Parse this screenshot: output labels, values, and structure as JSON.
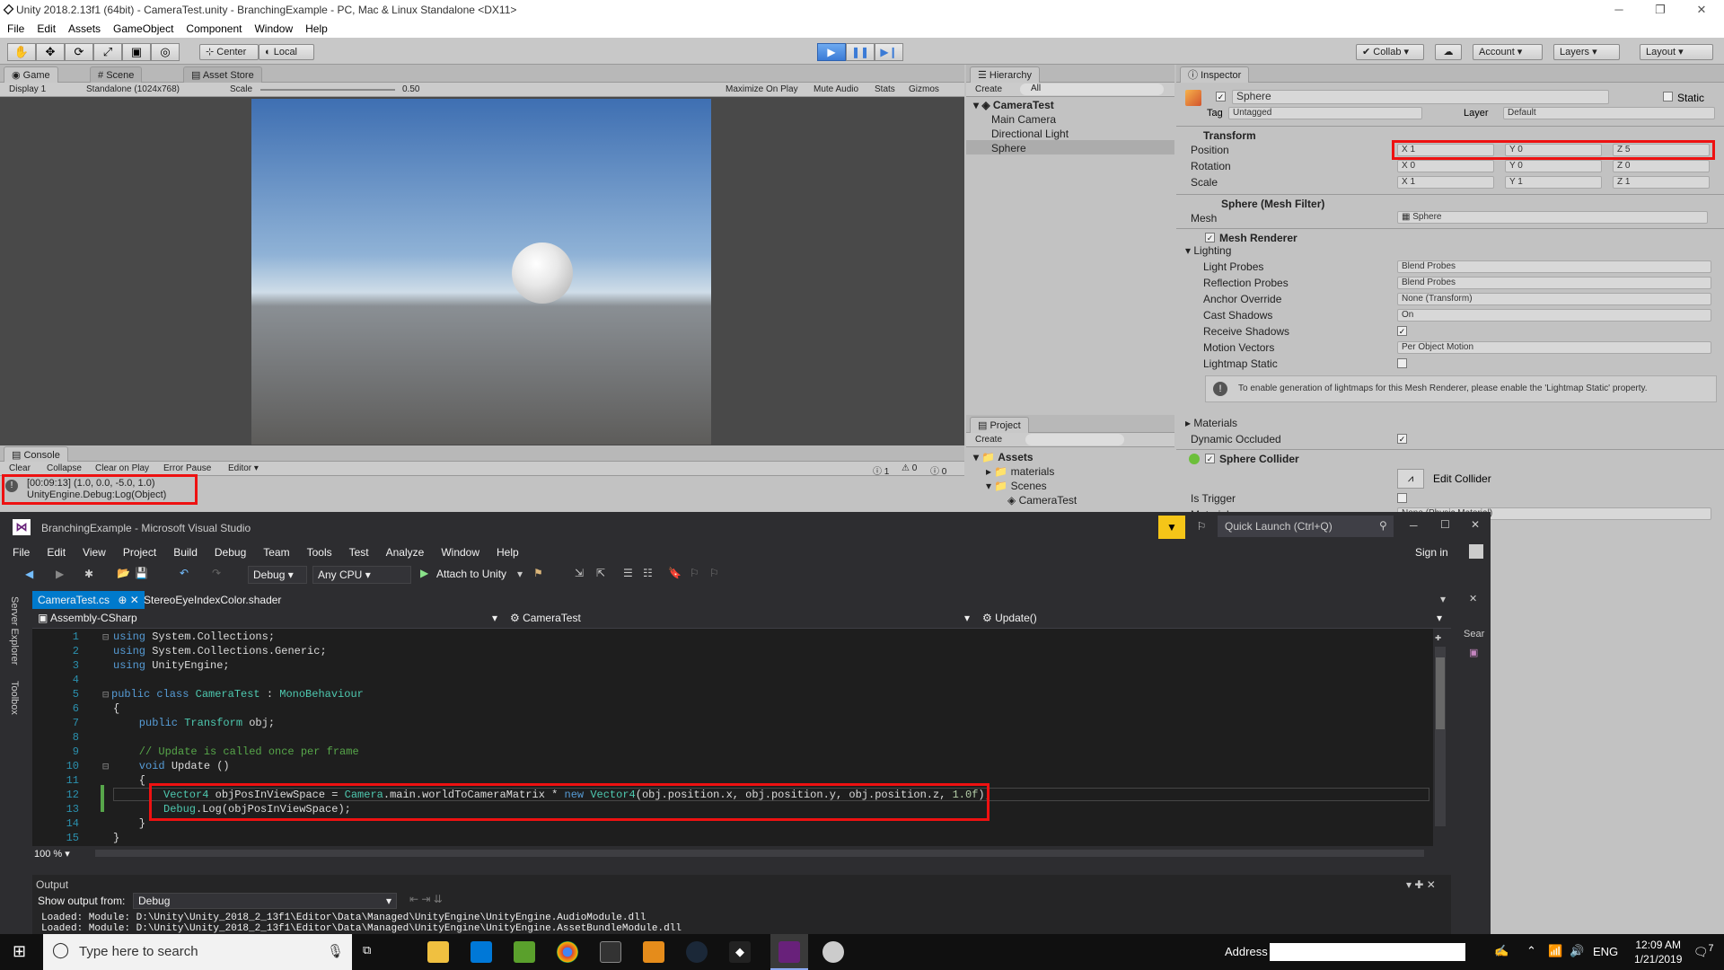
{
  "unity": {
    "title": "Unity 2018.2.13f1 (64bit) - CameraTest.unity - BranchingExample - PC, Mac & Linux Standalone <DX11>",
    "menu": [
      "File",
      "Edit",
      "Assets",
      "GameObject",
      "Component",
      "Window",
      "Help"
    ],
    "toolbar": {
      "center": "Center",
      "local": "Local",
      "collab": "Collab",
      "account": "Account",
      "layers": "Layers",
      "layout": "Layout"
    },
    "game": {
      "tab_game": "Game",
      "tab_scene": "Scene",
      "tab_store": "Asset Store",
      "display": "Display 1",
      "res": "Standalone (1024x768)",
      "scale_label": "Scale",
      "scale_value": "0.50",
      "maximize": "Maximize On Play",
      "mute": "Mute Audio",
      "stats": "Stats",
      "gizmos": "Gizmos"
    },
    "hierarchy": {
      "tab": "Hierarchy",
      "create": "Create",
      "search": "All",
      "scene": "CameraTest",
      "items": [
        "Main Camera",
        "Directional Light",
        "Sphere"
      ]
    },
    "project": {
      "tab": "Project",
      "create": "Create",
      "assets": "Assets",
      "folders": [
        "materials",
        "Scenes"
      ],
      "scene_file": "CameraTest"
    },
    "console": {
      "tab": "Console",
      "buttons": [
        "Clear",
        "Collapse",
        "Clear on Play",
        "Error Pause",
        "Editor"
      ],
      "counts": [
        "1",
        "0",
        "0"
      ],
      "line1": "[00:09:13] (1.0, 0.0, -5.0, 1.0)",
      "line2": "UnityEngine.Debug:Log(Object)"
    },
    "inspector": {
      "tab": "Inspector",
      "name": "Sphere",
      "static": "Static",
      "tag_label": "Tag",
      "tag": "Untagged",
      "layer_label": "Layer",
      "layer": "Default",
      "transform": "Transform",
      "position": {
        "label": "Position",
        "x": "1",
        "y": "0",
        "z": "5"
      },
      "rotation": {
        "label": "Rotation",
        "x": "0",
        "y": "0",
        "z": "0"
      },
      "scale": {
        "label": "Scale",
        "x": "1",
        "y": "1",
        "z": "1"
      },
      "mesh_filter": "Sphere (Mesh Filter)",
      "mesh_label": "Mesh",
      "mesh": "Sphere",
      "mesh_renderer": "Mesh Renderer",
      "lighting": "Lighting",
      "light_probes": {
        "label": "Light Probes",
        "value": "Blend Probes"
      },
      "reflection_probes": {
        "label": "Reflection Probes",
        "value": "Blend Probes"
      },
      "anchor_override": {
        "label": "Anchor Override",
        "value": "None (Transform)"
      },
      "cast_shadows": {
        "label": "Cast Shadows",
        "value": "On"
      },
      "receive_shadows": "Receive Shadows",
      "motion_vectors": {
        "label": "Motion Vectors",
        "value": "Per Object Motion"
      },
      "lightmap_static": "Lightmap Static",
      "info": "To enable generation of lightmaps for this Mesh Renderer, please enable the 'Lightmap Static' property.",
      "materials": "Materials",
      "dynamic_occluded": "Dynamic Occluded",
      "sphere_collider": "Sphere Collider",
      "edit_collider": "Edit Collider",
      "is_trigger": "Is Trigger",
      "material_label": "Material",
      "material_value": "None (Physic Material)"
    }
  },
  "vs": {
    "title": "BranchingExample - Microsoft Visual Studio",
    "quick_launch": "Quick Launch (Ctrl+Q)",
    "sign_in": "Sign in",
    "menu": [
      "File",
      "Edit",
      "View",
      "Project",
      "Build",
      "Debug",
      "Team",
      "Tools",
      "Test",
      "Analyze",
      "Window",
      "Help"
    ],
    "config": "Debug",
    "platform": "Any CPU",
    "attach": "Attach to Unity",
    "tabs": [
      "CameraTest.cs",
      "StereoEyeIndexColor.shader"
    ],
    "nav": {
      "project": "Assembly-CSharp",
      "class": "CameraTest",
      "member": "Update()"
    },
    "side": [
      "Server Explorer",
      "Toolbox"
    ],
    "zoom": "100 %",
    "output": {
      "title": "Output",
      "show_label": "Show output from:",
      "source": "Debug",
      "line1": "Loaded: Module: D:\\Unity\\Unity_2018_2_13f1\\Editor\\Data\\Managed\\UnityEngine\\UnityEngine.AudioModule.dll",
      "line2": "Loaded: Module: D:\\Unity\\Unity_2018_2_13f1\\Editor\\Data\\Managed\\UnityEngine\\UnityEngine.AssetBundleModule.dll"
    },
    "right_search": "Sear"
  },
  "code": {
    "lines": [
      "1",
      "2",
      "3",
      "4",
      "5",
      "6",
      "7",
      "8",
      "9",
      "10",
      "11",
      "12",
      "13",
      "14",
      "15"
    ],
    "l1a": "using",
    "l1b": " System.Collections;",
    "l2a": "using",
    "l2b": " System.Collections.Generic;",
    "l3a": "using",
    "l3b": " UnityEngine;",
    "l5a": "public class ",
    "l5b": "CameraTest",
    "l5c": " : ",
    "l5d": "MonoBehaviour",
    "l6": "{",
    "l7a": "    public ",
    "l7b": "Transform",
    "l7c": " obj;",
    "l9": "    // Update is called once per frame",
    "l10a": "    void ",
    "l10b": "Update ()",
    "l11": "    {",
    "l12a": "Vector4",
    "l12b": " objPosInViewSpace = ",
    "l12c": "Camera",
    "l12d": ".main.worldToCameraMatrix * ",
    "l12e": "new ",
    "l12f": "Vector4",
    "l12g": "(obj.position.x, obj.position.y, obj.position.z, ",
    "l12h": "1.0f",
    "l12i": ");",
    "l13a": "Debug",
    "l13b": ".Log(objPosInViewSpace);",
    "l14": "    }",
    "l15": "}"
  },
  "taskbar": {
    "search": "Type here to search",
    "address": "Address",
    "lang": "ENG",
    "time": "12:09 AM",
    "date": "1/21/2019",
    "notif": "7"
  },
  "colors": {
    "highlight": "#e11111",
    "vs_accent": "#007acc",
    "unity_play": "#3b7bd6"
  }
}
